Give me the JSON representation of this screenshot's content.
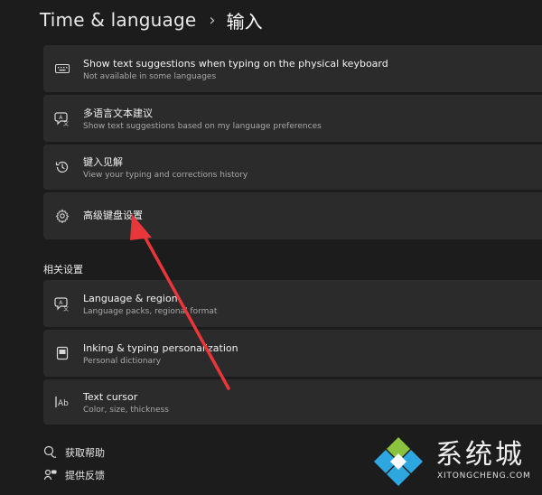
{
  "header": {
    "root": "Time & language",
    "separator": "›",
    "current": "输入"
  },
  "cards": [
    {
      "icon": "keyboard-icon",
      "title": "Show text suggestions when typing on the physical keyboard",
      "subtitle": "Not available in some languages"
    },
    {
      "icon": "language-text-icon",
      "title": "多语言文本建议",
      "subtitle": "Show text suggestions based on my language preferences"
    },
    {
      "icon": "history-icon",
      "title": "键入见解",
      "subtitle": "View your typing and corrections history"
    },
    {
      "icon": "gear-icon",
      "title": "高级键盘设置",
      "subtitle": ""
    }
  ],
  "related": {
    "title": "相关设置",
    "items": [
      {
        "icon": "language-region-icon",
        "title": "Language & region",
        "subtitle": "Language packs, regional format"
      },
      {
        "icon": "pen-icon",
        "title": "Inking & typing personalization",
        "subtitle": "Personal dictionary"
      },
      {
        "icon": "text-cursor-icon",
        "title": "Text cursor",
        "subtitle": "Color, size, thickness"
      }
    ]
  },
  "footer": {
    "help": "获取帮助",
    "feedback": "提供反馈"
  },
  "watermark": {
    "cn": "系统城",
    "en": "XITONGCHENG.COM"
  },
  "colors": {
    "background": "#1c1c1c",
    "card": "#2b2b2b",
    "arrow": "#e8363a"
  }
}
